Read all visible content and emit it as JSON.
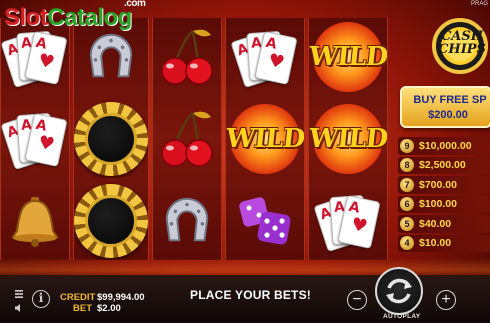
{
  "watermark": {
    "slot": "Slot",
    "catalog": "Catalog",
    "tld": ".com"
  },
  "provider_label": "PRAG",
  "logo": {
    "line1": "CASH",
    "line2": "CHIPS"
  },
  "buy_feature": {
    "label": "BUY FREE SP",
    "price": "$200.00"
  },
  "paytable": [
    {
      "count": "9",
      "value": "$10,000.00"
    },
    {
      "count": "8",
      "value": "$2,500.00"
    },
    {
      "count": "7",
      "value": "$700.00"
    },
    {
      "count": "6",
      "value": "$100.00"
    },
    {
      "count": "5",
      "value": "$40.00"
    },
    {
      "count": "4",
      "value": "$10.00"
    }
  ],
  "reels": [
    [
      "cards",
      "cards",
      "bell"
    ],
    [
      "horseshoe",
      "chip",
      "chip"
    ],
    [
      "cherries",
      "cherries",
      "horseshoe"
    ],
    [
      "cards",
      "wild",
      "dice"
    ],
    [
      "wild",
      "wild",
      "cards"
    ]
  ],
  "wild_label": "WILD",
  "card_rank": "A",
  "card_suit": "♥",
  "status": {
    "credit_label": "CREDIT",
    "credit_value": "$99,994.00",
    "bet_label": "BET",
    "bet_value": "$2.00",
    "message": "PLACE YOUR BETS!"
  },
  "controls": {
    "minus": "−",
    "plus": "+",
    "autoplay": "AUTOPLAY"
  },
  "colors": {
    "accent_gold": "#f2b632",
    "background_red": "#b5220f",
    "panel_text_blue": "#1d2a8c"
  }
}
